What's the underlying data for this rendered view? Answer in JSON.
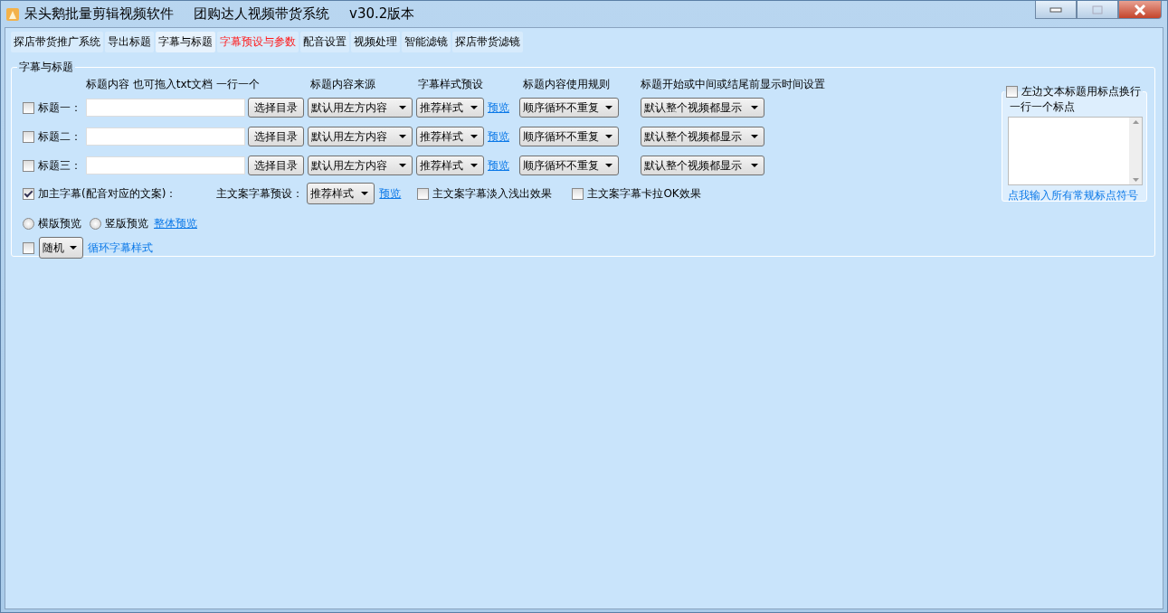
{
  "window": {
    "title": "呆头鹅批量剪辑视频软件",
    "subtitle": "团购达人视频带货系统",
    "version": "v30.2版本"
  },
  "tabs": [
    {
      "label": "探店带货推广系统",
      "selected": false,
      "highlighted": false
    },
    {
      "label": "导出标题",
      "selected": false,
      "highlighted": false
    },
    {
      "label": "字幕与标题",
      "selected": true,
      "highlighted": false
    },
    {
      "label": "字幕预设与参数",
      "selected": false,
      "highlighted": true
    },
    {
      "label": "配音设置",
      "selected": false,
      "highlighted": false
    },
    {
      "label": "视频处理",
      "selected": false,
      "highlighted": false
    },
    {
      "label": "智能滤镜",
      "selected": false,
      "highlighted": false
    },
    {
      "label": "探店带货滤镜",
      "selected": false,
      "highlighted": false
    }
  ],
  "group": {
    "title": "字幕与标题",
    "headers": [
      "标题内容 也可拖入txt文档 一行一个",
      "标题内容来源",
      "字幕样式预设",
      "标题内容使用规则",
      "标题开始或中间或结尾前显示时间设置"
    ],
    "title_rows": [
      {
        "label": "标题一：",
        "checked": false,
        "browse_button": "选择目录",
        "source": "默认用左方内容",
        "style": "推荐样式",
        "preview_link": "预览",
        "rule": "顺序循环不重复",
        "display": "默认整个视频都显示"
      },
      {
        "label": "标题二：",
        "checked": false,
        "browse_button": "选择目录",
        "source": "默认用左方内容",
        "style": "推荐样式",
        "preview_link": "预览",
        "rule": "顺序循环不重复",
        "display": "默认整个视频都显示"
      },
      {
        "label": "标题三：",
        "checked": false,
        "browse_button": "选择目录",
        "source": "默认用左方内容",
        "style": "推荐样式",
        "preview_link": "预览",
        "rule": "顺序循环不重复",
        "display": "默认整个视频都显示"
      }
    ],
    "main_subtitle": {
      "label": "加主字幕(配音对应的文案)：",
      "checked": true,
      "preset_label": "主文案字幕预设：",
      "preset": "推荐样式",
      "preview_link": "预览",
      "options": [
        {
          "label": "主文案字幕淡入浅出效果",
          "checked": false
        },
        {
          "label": "主文案字幕卡拉OK效果",
          "checked": false
        }
      ]
    },
    "preview_modes": [
      {
        "label": "横版预览",
        "selected": false
      },
      {
        "label": "竖版预览",
        "selected": false
      }
    ],
    "overall_preview_link": "整体预览",
    "cycle": {
      "checked": false,
      "mode": "随机",
      "link": "循环字幕样式"
    },
    "punctuation": {
      "label": "左边文本标题用标点换行",
      "checked": false,
      "list_label": "一行一个标点",
      "link": "点我输入所有常规标点符号"
    }
  }
}
